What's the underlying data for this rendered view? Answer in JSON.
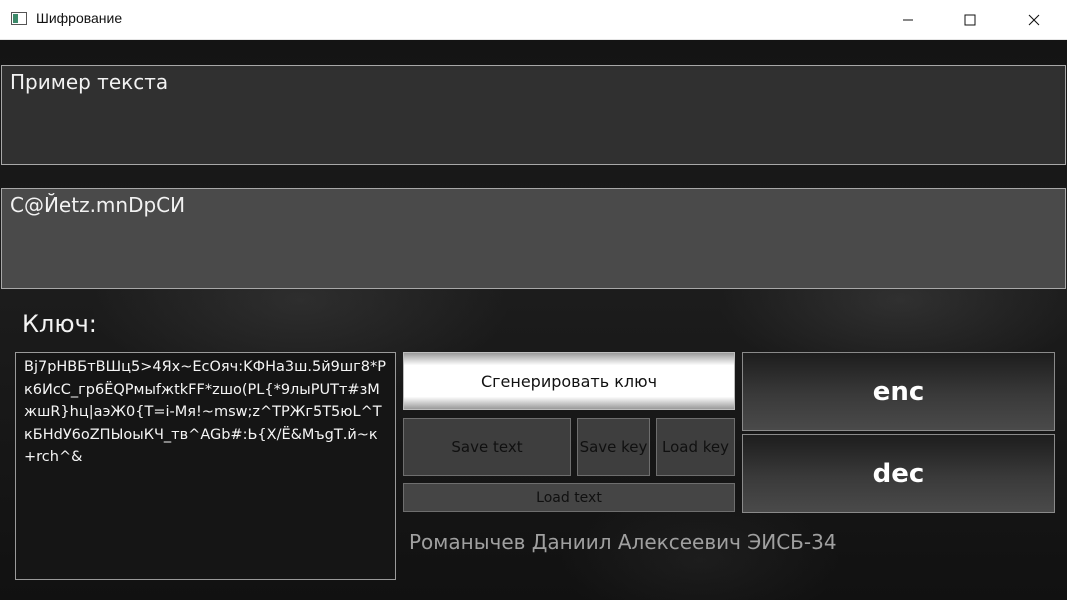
{
  "window": {
    "title": "Шифрование",
    "icon": "app-window-icon",
    "controls": [
      "minimize-icon",
      "maximize-icon",
      "close-icon"
    ]
  },
  "plaintext": {
    "value": "Пример текста"
  },
  "ciphertext": {
    "value": "C@Йetz.mnDpСИ"
  },
  "key": {
    "label": "Ключ:",
    "value": "Bj7pHBБтВШц5>4Яx~EcОяч:KФНа3ш.5й9шг8*Pк6ИсC_гр6ЁQPмыfжtkFF*zшо(PL{*9лыPUТт#зМжшR}hц|аэЖ0{T=i-Мя!~msw;z^ТРЖг5Т5юL^ТкБНdУ6oZПЫоыКЧ_тв^AGb#:Ь{X/Ё&МъgТ.й~к+rch^&"
  },
  "buttons": {
    "generate_key": "Сгенерировать ключ",
    "save_text": "Save text",
    "save_key": "Save key",
    "load_key": "Load key",
    "load_text": "Load text",
    "encrypt": "enc",
    "decrypt": "dec"
  },
  "author": "Романычев Даниил Алексеевич ЭИСБ-34",
  "colors": {
    "background": "#0e0e0e",
    "text_field": "#303030",
    "cipher_field": "#4a4a4a",
    "button": "#3e3e3e"
  }
}
